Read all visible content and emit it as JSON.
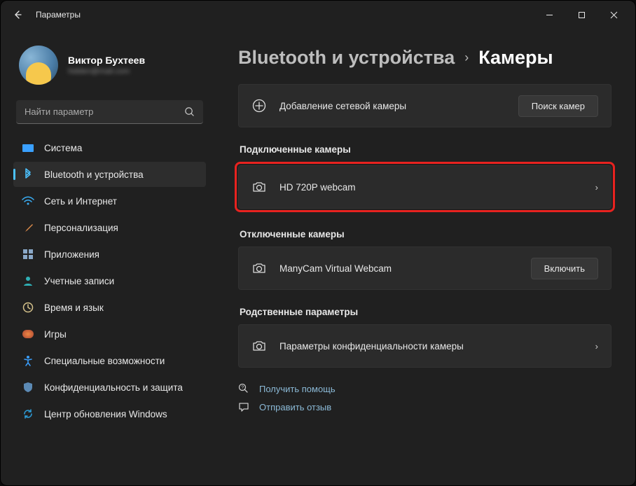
{
  "titlebar": {
    "title": "Параметры"
  },
  "user": {
    "name": "Виктор Бухтеев",
    "email": "hidden@mail.com"
  },
  "search": {
    "placeholder": "Найти параметр"
  },
  "nav": {
    "system": "Система",
    "bluetooth": "Bluetooth и устройства",
    "network": "Сеть и Интернет",
    "personalization": "Персонализация",
    "apps": "Приложения",
    "accounts": "Учетные записи",
    "time": "Время и язык",
    "games": "Игры",
    "accessibility": "Специальные возможности",
    "privacy": "Конфиденциальность и защита",
    "update": "Центр обновления Windows"
  },
  "breadcrumb": {
    "parent": "Bluetooth и устройства",
    "current": "Камеры"
  },
  "add_camera": {
    "label": "Добавление сетевой камеры",
    "button": "Поиск камер"
  },
  "sections": {
    "connected": "Подключенные камеры",
    "disabled": "Отключенные камеры",
    "related": "Родственные параметры"
  },
  "connected_camera": {
    "name": "HD 720P webcam"
  },
  "disabled_camera": {
    "name": "ManyCam Virtual Webcam",
    "enable_btn": "Включить"
  },
  "privacy_row": {
    "label": "Параметры конфиденциальности камеры"
  },
  "footer": {
    "help": "Получить помощь",
    "feedback": "Отправить отзыв"
  }
}
